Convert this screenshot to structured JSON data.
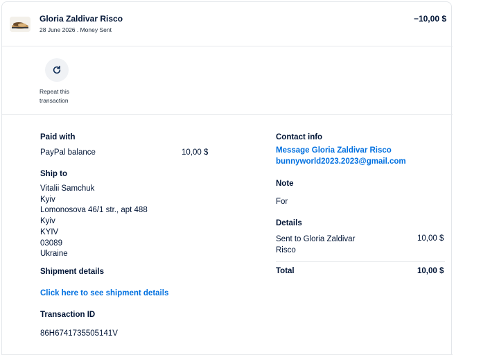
{
  "transaction": {
    "name": "Gloria Zaldivar Risco",
    "subtitle": "28 June 2026 . Money Sent",
    "amount": "−10,00 $"
  },
  "actions": {
    "repeat_label": "Repeat this transaction",
    "repeat_icon": "refresh-icon"
  },
  "paid_with": {
    "heading": "Paid with",
    "method": "PayPal balance",
    "amount": "10,00 $"
  },
  "ship_to": {
    "heading": "Ship to",
    "lines": [
      "Vitalii Samchuk",
      "Kyiv",
      "Lomonosova 46/1 str., apt 488",
      "Kyiv",
      "KYIV",
      "03089",
      "Ukraine"
    ]
  },
  "shipment": {
    "heading": "Shipment details",
    "link": "Click here to see shipment details"
  },
  "transaction_id": {
    "heading": "Transaction ID",
    "value": "86H6741735505141V"
  },
  "contact": {
    "heading": "Contact info",
    "message_link": "Message Gloria Zaldivar Risco",
    "email": "bunnyworld2023.2023@gmail.com"
  },
  "note": {
    "heading": "Note",
    "text": "For"
  },
  "details": {
    "heading": "Details",
    "sent_to": "Sent to Gloria Zaldivar Risco",
    "sent_amount": "10,00 $",
    "total_label": "Total",
    "total_amount": "10,00 $"
  },
  "colors": {
    "text": "#001435",
    "link": "#0070e0",
    "divider": "#e6e8eb"
  }
}
